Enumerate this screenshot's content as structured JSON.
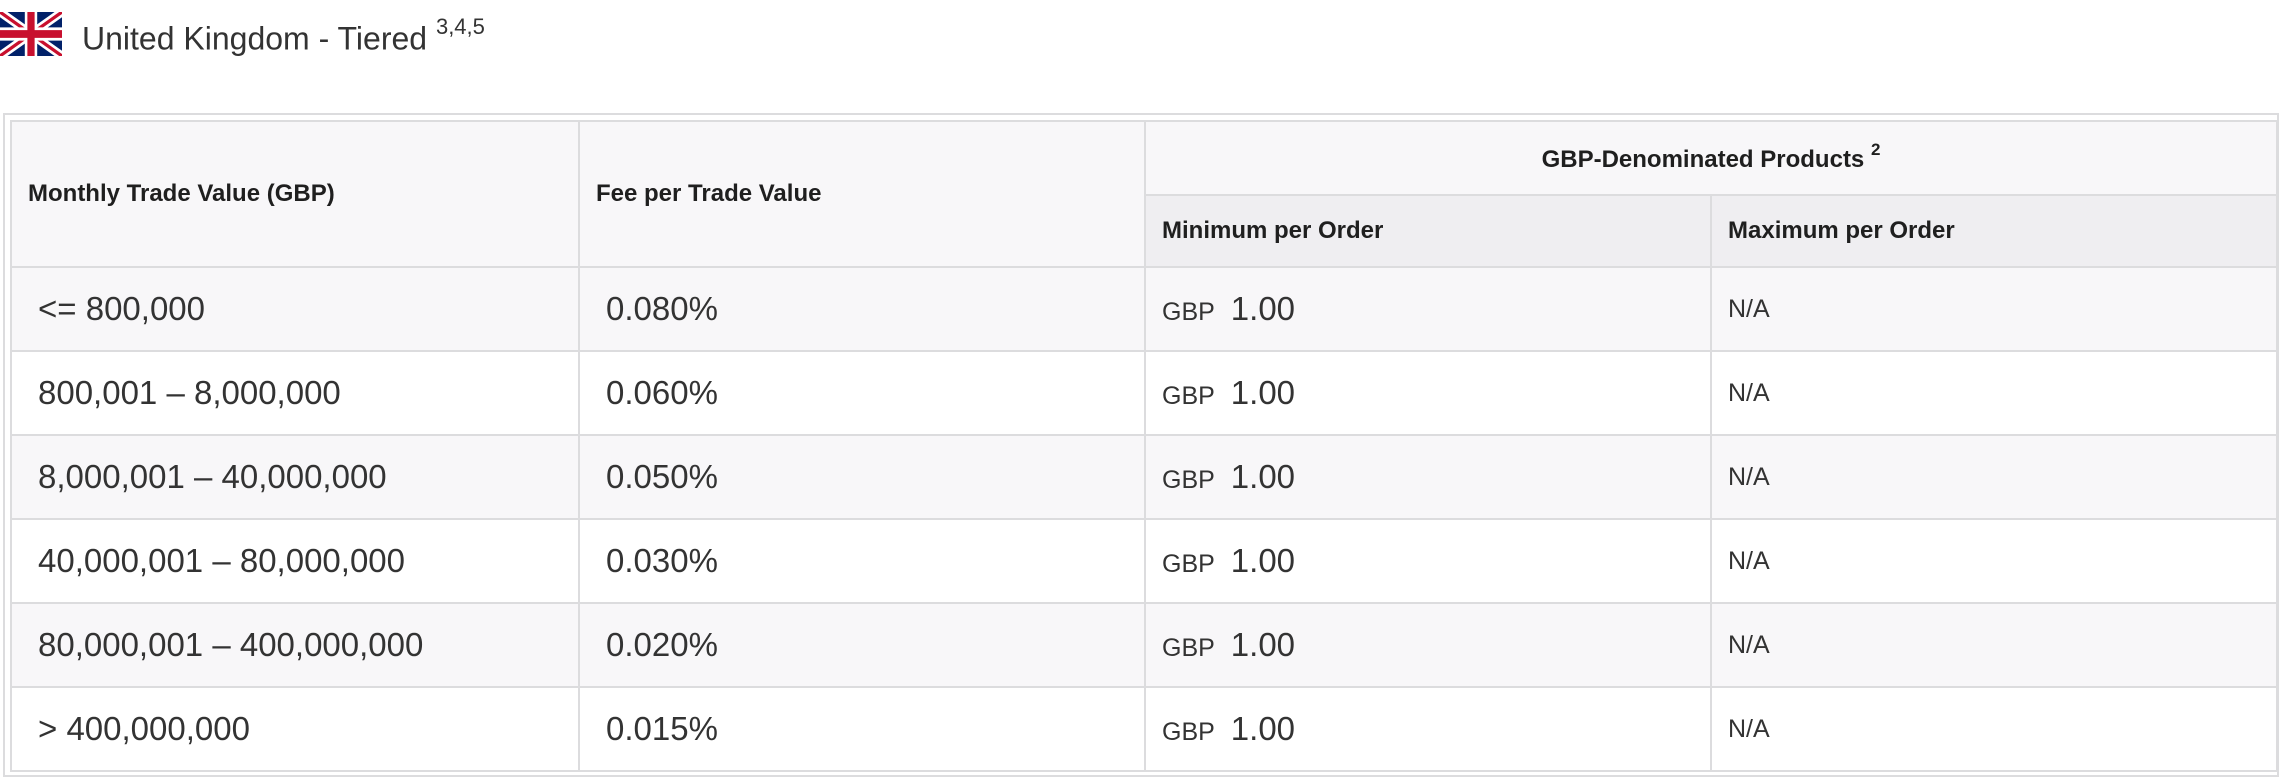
{
  "heading": {
    "title": "United Kingdom - Tiered",
    "footnotes": "3,4,5",
    "flag_icon": "uk-flag-icon"
  },
  "table": {
    "col_trade_value": "Monthly Trade Value (GBP)",
    "col_fee": "Fee per Trade Value",
    "group_header": "GBP-Denominated Products",
    "group_footnote": "2",
    "col_min": "Minimum per Order",
    "col_max": "Maximum per Order",
    "rows": [
      {
        "range": "<= 800,000",
        "fee": "0.080%",
        "min_currency": "GBP",
        "min_value": "1.00",
        "max": "N/A"
      },
      {
        "range": "800,001 – 8,000,000",
        "fee": "0.060%",
        "min_currency": "GBP",
        "min_value": "1.00",
        "max": "N/A"
      },
      {
        "range": "8,000,001 – 40,000,000",
        "fee": "0.050%",
        "min_currency": "GBP",
        "min_value": "1.00",
        "max": "N/A"
      },
      {
        "range": "40,000,001 – 80,000,000",
        "fee": "0.030%",
        "min_currency": "GBP",
        "min_value": "1.00",
        "max": "N/A"
      },
      {
        "range": "80,000,001 – 400,000,000",
        "fee": "0.020%",
        "min_currency": "GBP",
        "min_value": "1.00",
        "max": "N/A"
      },
      {
        "range": "> 400,000,000",
        "fee": "0.015%",
        "min_currency": "GBP",
        "min_value": "1.00",
        "max": "N/A"
      }
    ]
  },
  "colors": {
    "border": "#dcdcde",
    "header_bg": "#f8f7f9",
    "subheader_bg": "#efeef1",
    "flag_blue": "#012169",
    "flag_red": "#C8102E"
  }
}
